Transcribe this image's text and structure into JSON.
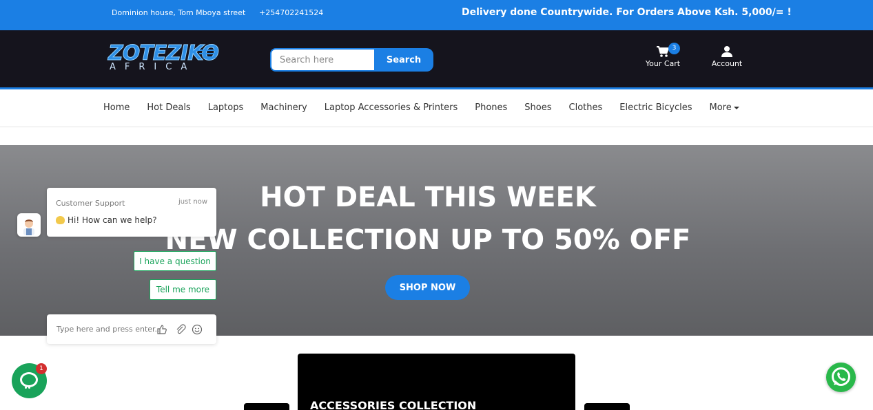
{
  "topbar": {
    "address": "Dominion house, Tom Mboya street",
    "phone": "+254702241524",
    "announcement": "Delivery done Countrywide. For Orders Above Ksh. 5,000/= !"
  },
  "header": {
    "logo_text": "ZOTEZIKO",
    "logo_sub": "AFRICA",
    "search": {
      "placeholder": "Search here",
      "button_label": "Search"
    },
    "cart": {
      "label": "Your Cart",
      "count": "3"
    },
    "account": {
      "label": "Account"
    }
  },
  "nav": {
    "items": [
      {
        "label": "Home"
      },
      {
        "label": "Hot Deals"
      },
      {
        "label": "Laptops"
      },
      {
        "label": "Machinery"
      },
      {
        "label": "Laptop Accessories & Printers"
      },
      {
        "label": "Phones"
      },
      {
        "label": "Shoes"
      },
      {
        "label": "Clothes"
      },
      {
        "label": "Electric Bicycles"
      },
      {
        "label": "More"
      }
    ]
  },
  "hero": {
    "line1": "HOT DEAL THIS WEEK",
    "line2": "NEW COLLECTION UP TO 50% OFF",
    "button_label": "SHOP NOW"
  },
  "promo": {
    "title": "ACCESSORIES COLLECTION"
  },
  "chat": {
    "agent_name": "Customer Support",
    "time": "just now",
    "message": "Hi! How can we help?",
    "quick_replies": [
      "I have a question",
      "Tell me more"
    ],
    "input_placeholder": "Type here and press enter..",
    "unread_count": "1"
  },
  "colors": {
    "brand_blue": "#1b7fe4",
    "header_dark": "#15141d",
    "chat_green": "#19a35a",
    "whatsapp_green": "#29b84a"
  }
}
